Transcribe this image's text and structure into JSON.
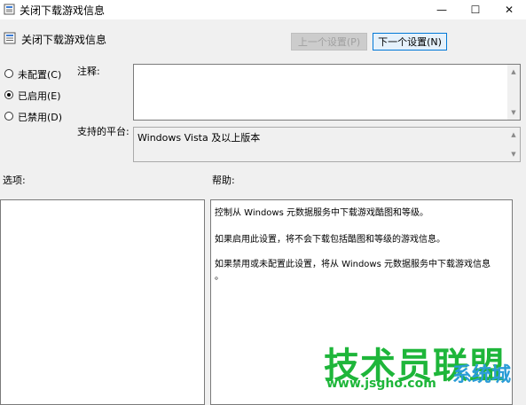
{
  "window": {
    "title": "关闭下载游戏信息",
    "minimize_glyph": "—",
    "maximize_glyph": "☐",
    "close_glyph": "✕"
  },
  "header": {
    "setting_name": "关闭下载游戏信息",
    "prev_button": "上一个设置(P)",
    "next_button": "下一个设置(N)"
  },
  "options": {
    "not_configured": "未配置(C)",
    "enabled": "已启用(E)",
    "disabled": "已禁用(D)",
    "selected": "enabled"
  },
  "comment": {
    "label": "注释:",
    "value": ""
  },
  "platform": {
    "label": "支持的平台:",
    "value": "Windows Vista 及以上版本"
  },
  "sections": {
    "options_label": "选项:",
    "help_label": "帮助:"
  },
  "help": {
    "line1": "控制从 Windows 元数据服务中下载游戏酷图和等级。",
    "line2": "如果启用此设置，将不会下载包括酷图和等级的游戏信息。",
    "line3a": "如果禁用或未配置此设置，将从 Windows 元数据服务中下载游戏信息",
    "line3b": "。"
  },
  "watermark": {
    "main": "技术员联盟",
    "url": "www.jsgho.com",
    "side": "系统城"
  },
  "colors": {
    "accent": "#0078d7",
    "watermark_green": "#1eb63a",
    "watermark_blue": "#2a9cd7"
  }
}
